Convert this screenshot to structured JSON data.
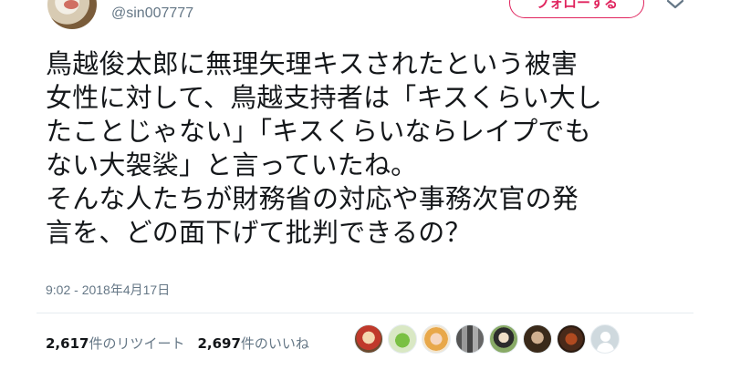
{
  "tweet": {
    "handle": "@sin007777",
    "follow_label": "フォローする",
    "text": "鳥越俊太郎に無理矢理キスされたという被害\n女性に対して、鳥越支持者は「キスくらい大し\nたことじゃない」「キスくらいならレイプでも\nない大袈裟」と言っていたね。\nそんな人たちが財務省の対応や事務次官の発\n言を、どの面下げて批判できるの？",
    "timestamp": "9:02 - 2018年4月17日"
  },
  "stats": {
    "retweets_count": "2,617",
    "retweets_label": "件のリツイート",
    "likes_count": "2,697",
    "likes_label": "件のいいね"
  },
  "colors": {
    "follow_accent": "#e0245e",
    "secondary_text": "#657786",
    "primary_text": "#14171a"
  },
  "icons": {
    "chevron": "chevron-down-icon"
  }
}
